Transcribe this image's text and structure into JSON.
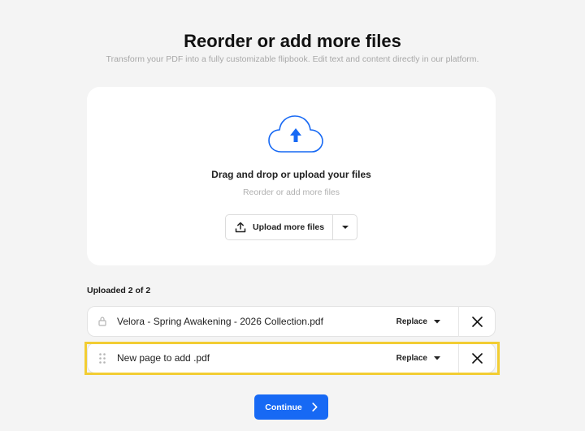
{
  "header": {
    "title": "Reorder or add more files",
    "subtitle": "Transform your PDF into a fully customizable flipbook. Edit text and content directly in our platform."
  },
  "dropzone": {
    "title": "Drag and drop or upload your files",
    "hint": "Reorder or add more files",
    "upload_label": "Upload more files",
    "icon": "cloud-upload-icon"
  },
  "files": {
    "status": "Uploaded 2 of 2",
    "items": [
      {
        "name": "Velora - Spring Awakening - 2026 Collection.pdf",
        "lead_icon": "lock-icon",
        "replace_label": "Replace"
      },
      {
        "name": "New page to add .pdf",
        "lead_icon": "drag-handle-icon",
        "replace_label": "Replace"
      }
    ]
  },
  "footer": {
    "continue_label": "Continue"
  },
  "colors": {
    "accent": "#1769f4",
    "highlight": "#f2cd33",
    "background": "#f4f4f4"
  }
}
